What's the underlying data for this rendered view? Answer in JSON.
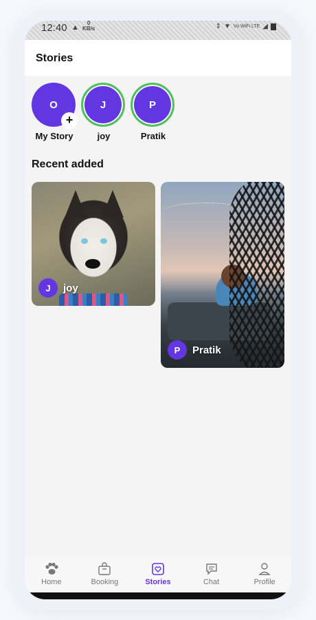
{
  "status_bar": {
    "time": "12:40",
    "speed_value": "0",
    "speed_unit": "KB/s",
    "network": "Vo WiFi LTE"
  },
  "header": {
    "title": "Stories"
  },
  "stories": [
    {
      "initial": "O",
      "name": "My Story",
      "add": "+"
    },
    {
      "initial": "J",
      "name": "joy"
    },
    {
      "initial": "P",
      "name": "Pratik"
    }
  ],
  "recent": {
    "title": "Recent added",
    "cards": [
      {
        "initial": "J",
        "name": "joy"
      },
      {
        "initial": "P",
        "name": "Pratik"
      }
    ]
  },
  "tabs": [
    {
      "label": "Home",
      "icon": "paw-icon"
    },
    {
      "label": "Booking",
      "icon": "bag-icon"
    },
    {
      "label": "Stories",
      "icon": "stories-icon",
      "active": true
    },
    {
      "label": "Chat",
      "icon": "chat-icon"
    },
    {
      "label": "Profile",
      "icon": "profile-icon"
    }
  ],
  "colors": {
    "accent": "#6236e0",
    "ring": "#4fc25a"
  }
}
